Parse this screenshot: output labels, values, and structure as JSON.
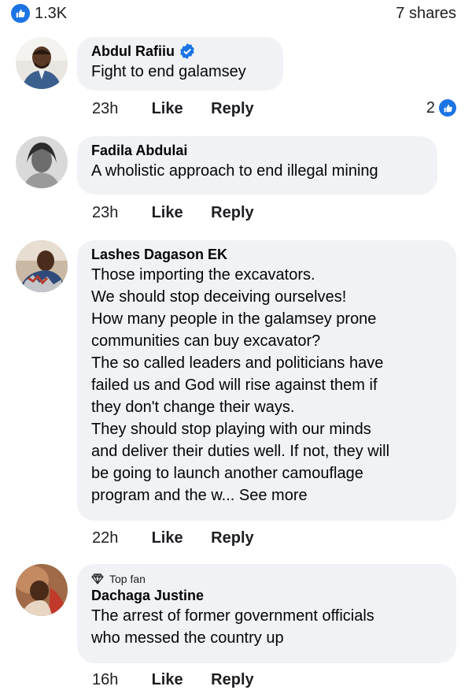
{
  "post": {
    "like_count": "1.3K",
    "shares": "7 shares"
  },
  "comments": [
    {
      "name": "Abdul Rafiiu",
      "verified": true,
      "text": "Fight to end galamsey",
      "time": "23h",
      "like_label": "Like",
      "reply_label": "Reply",
      "reaction_count": "2"
    },
    {
      "name": "Fadila Abdulai",
      "text": "A wholistic approach to end illegal mining",
      "time": "23h",
      "like_label": "Like",
      "reply_label": "Reply"
    },
    {
      "name": "Lashes Dagason EK",
      "text": "Those importing the excavators.\nWe should stop deceiving ourselves!\nHow many people in the galamsey prone\ncommunities can buy excavator?\nThe so called leaders and politicians have\nfailed us and God will rise against them if\nthey don't change their ways.\nThey should stop playing with our minds\nand deliver their duties well. If not, they will\nbe going to launch another camouflage\nprogram and the w...",
      "see_more": "See more",
      "time": "22h",
      "like_label": "Like",
      "reply_label": "Reply"
    },
    {
      "badge": "Top fan",
      "name": "Dachaga Justine",
      "text": "The arrest of former government officials\nwho messed the country up",
      "time": "16h",
      "like_label": "Like",
      "reply_label": "Reply"
    }
  ],
  "colors": {
    "accent": "#1b74e4",
    "bubble": "#f0f2f5"
  }
}
